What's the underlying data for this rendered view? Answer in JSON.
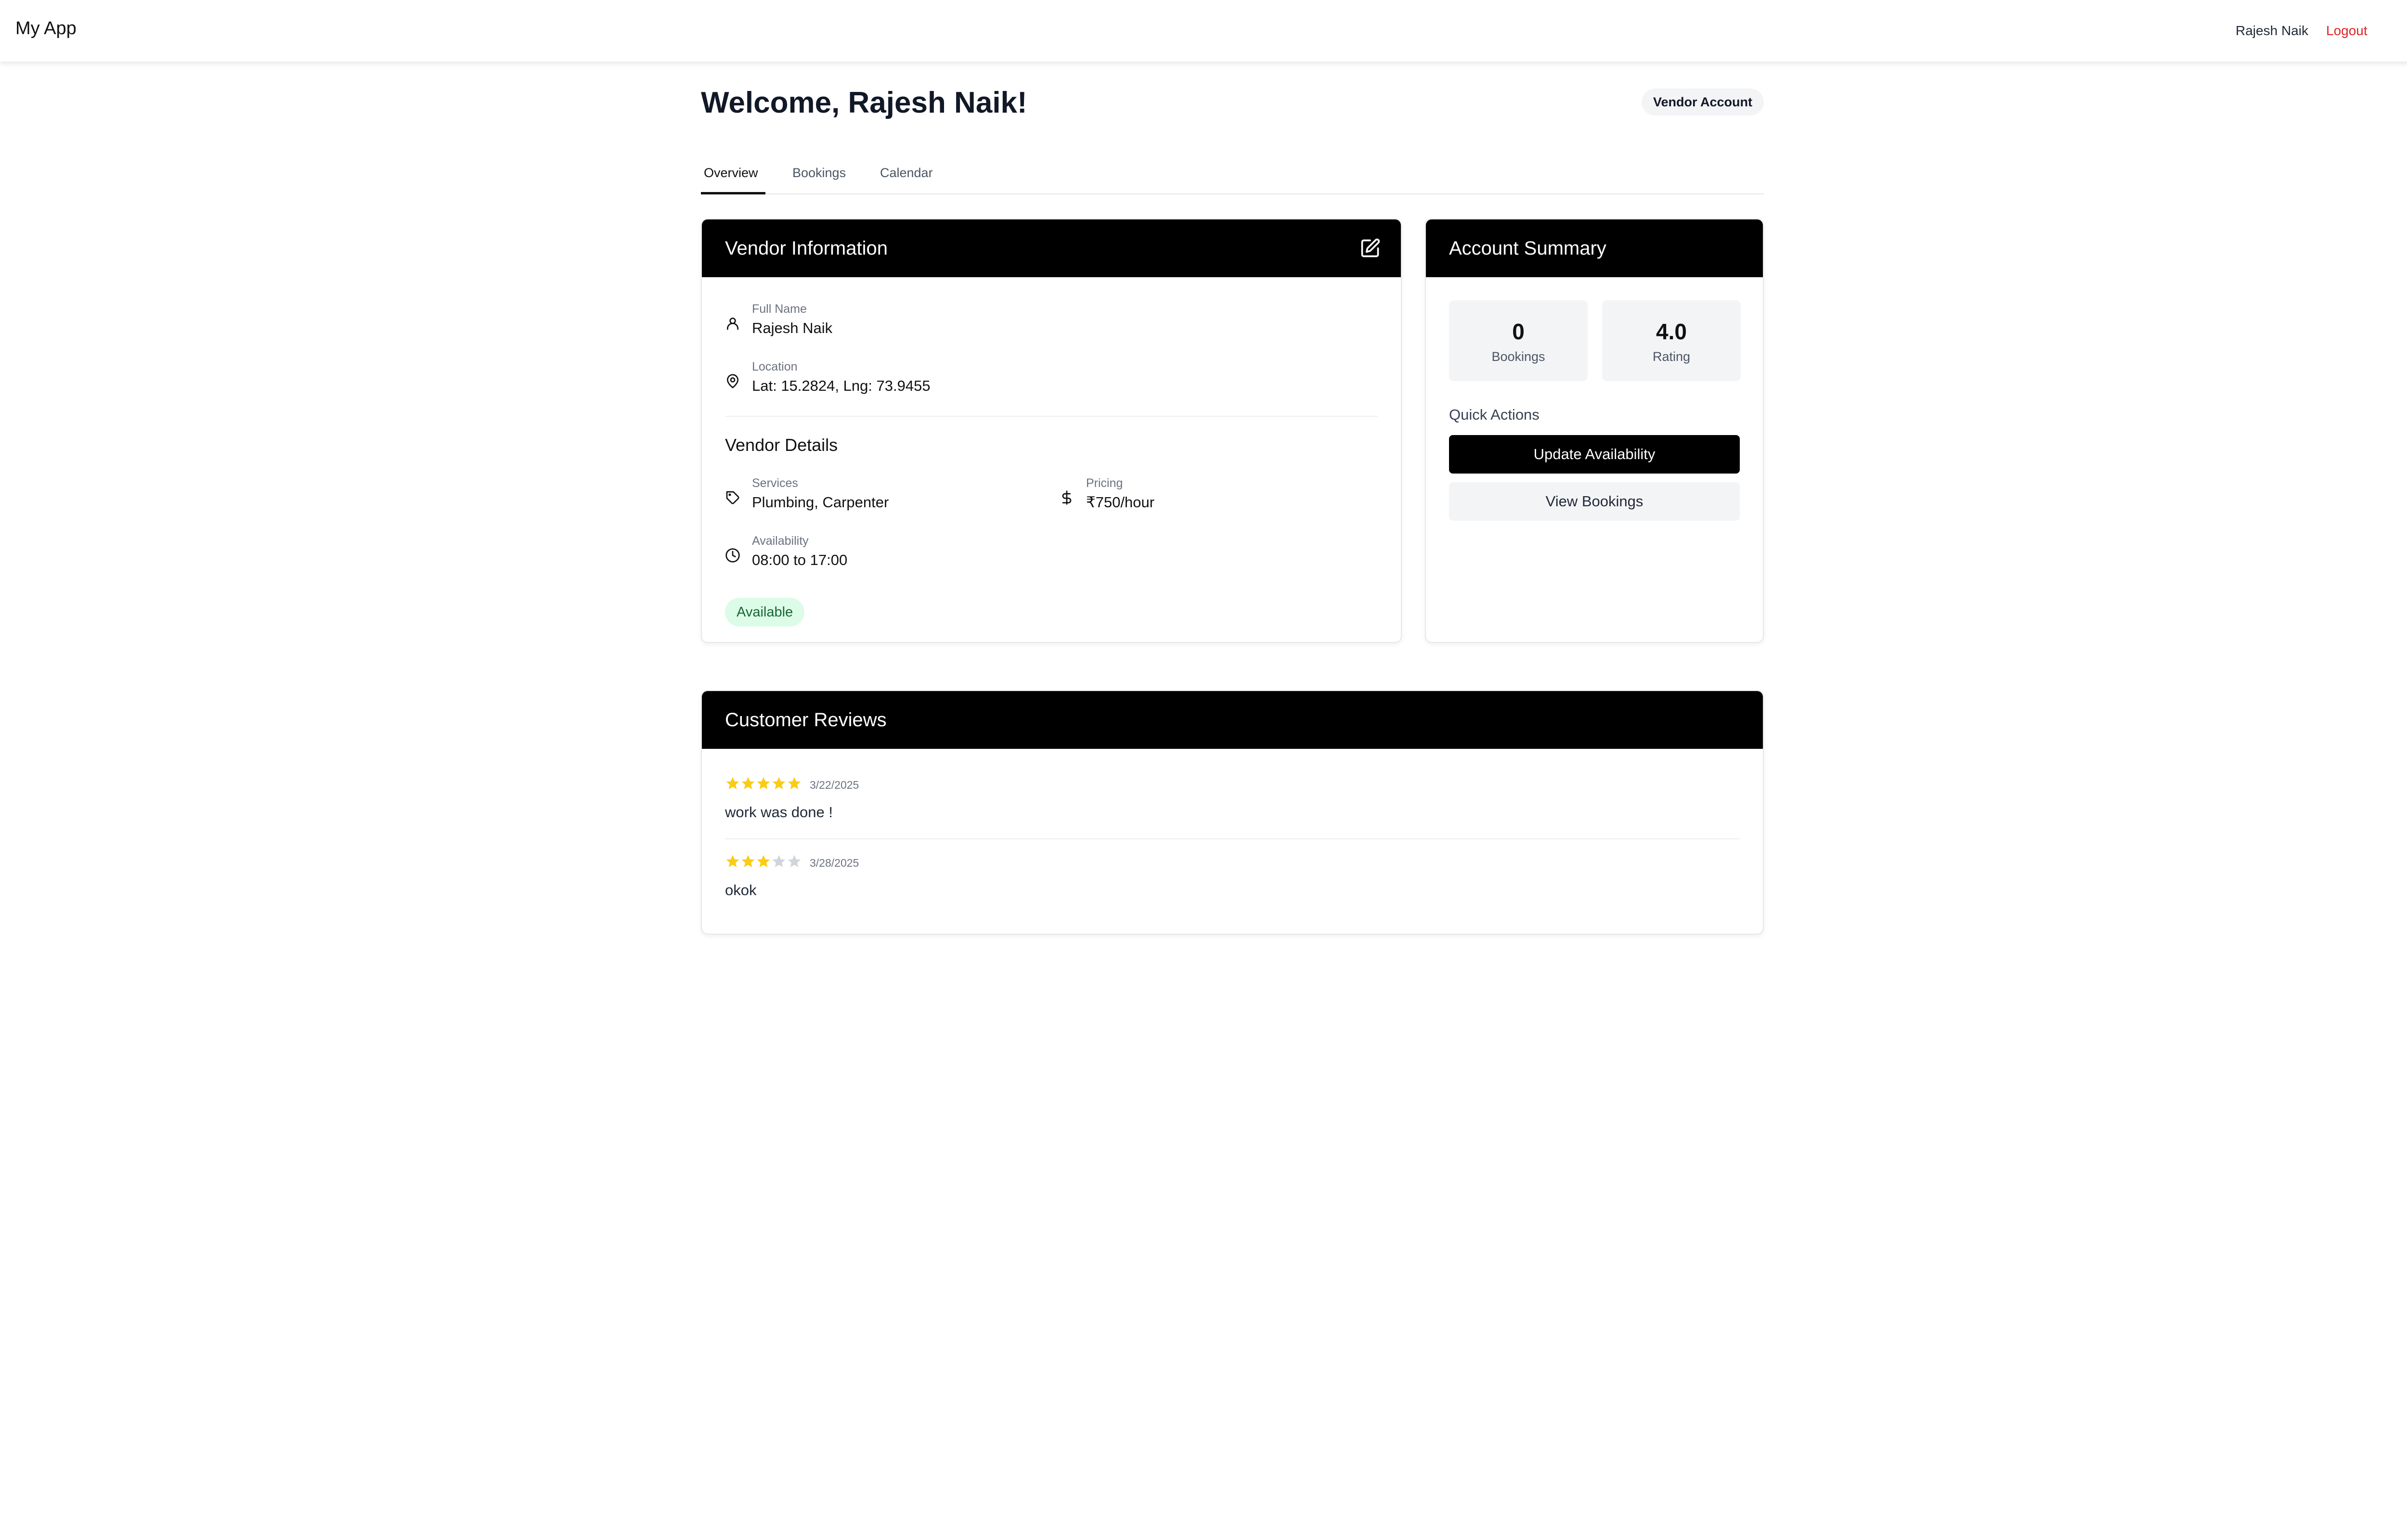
{
  "app": {
    "name": "My App",
    "user_name": "Rajesh Naik",
    "logout_label": "Logout",
    "logo_icon": "diamond-logo-icon",
    "logo_color": "#7c6cc4"
  },
  "page": {
    "welcome": "Welcome, Rajesh Naik!",
    "account_badge": "Vendor Account"
  },
  "tabs": [
    {
      "label": "Overview",
      "active": true
    },
    {
      "label": "Bookings",
      "active": false
    },
    {
      "label": "Calendar",
      "active": false
    }
  ],
  "vendor_info": {
    "title": "Vendor Information",
    "edit_icon": "edit-icon",
    "full_name_label": "Full Name",
    "full_name": "Rajesh Naik",
    "location_label": "Location",
    "location": "Lat: 15.2824, Lng: 73.9455",
    "details_title": "Vendor Details",
    "services_label": "Services",
    "services": "Plumbing, Carpenter",
    "pricing_label": "Pricing",
    "pricing": "₹750/hour",
    "availability_label": "Availability",
    "availability": "08:00 to 17:00",
    "status": "Available",
    "icons": {
      "name": "user-icon",
      "location": "map-pin-icon",
      "services": "tag-icon",
      "pricing": "dollar-icon",
      "availability": "clock-icon"
    }
  },
  "summary": {
    "title": "Account Summary",
    "bookings_value": "0",
    "bookings_label": "Bookings",
    "rating_value": "4.0",
    "rating_label": "Rating",
    "quick_actions_label": "Quick Actions",
    "update_button": "Update Availability",
    "view_button": "View Bookings"
  },
  "reviews": {
    "title": "Customer Reviews",
    "items": [
      {
        "rating": 5,
        "date": "3/22/2025",
        "text": "work was done !"
      },
      {
        "rating": 3,
        "date": "3/28/2025",
        "text": "okok"
      }
    ]
  },
  "colors": {
    "accent": "#000000",
    "logout": "#dc2626",
    "available_bg": "#dcfce7",
    "available_text": "#166534",
    "star_filled": "#facc15",
    "star_empty": "#d1d5db"
  }
}
